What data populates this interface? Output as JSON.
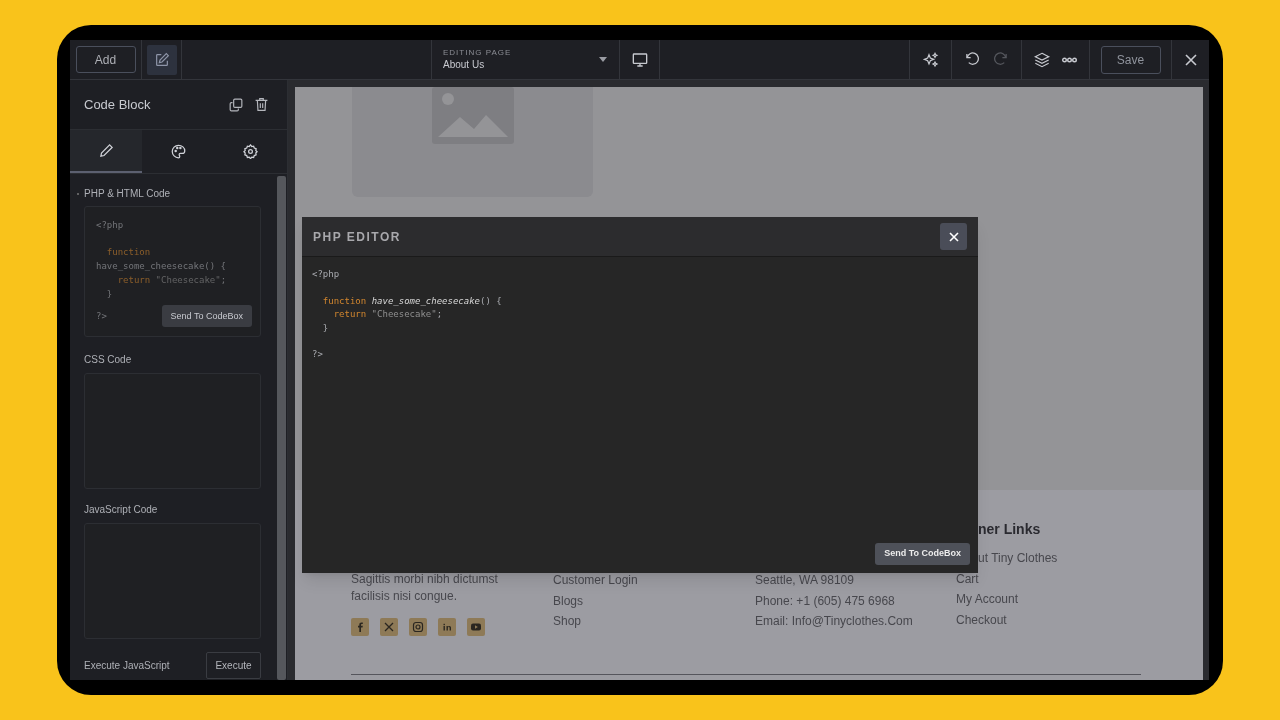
{
  "toolbar": {
    "add_button": "Add",
    "editing_label": "EDITING PAGE",
    "page_name": "About Us",
    "redo": {
      "disabled": true
    },
    "save_button": "Save"
  },
  "panel": {
    "title": "Code Block",
    "tabs": [
      {
        "kind": "pencil",
        "selected": true
      },
      {
        "kind": "palette",
        "selected": false
      },
      {
        "kind": "gear",
        "selected": false
      }
    ],
    "php_label": "PHP & HTML Code",
    "php_code": [
      {
        "lines": [
          {
            "tokens": [
              {
                "kind": "plain",
                "text": "<?php"
              }
            ]
          }
        ]
      },
      {
        "lines": [
          {
            "tokens": [
              {
                "kind": "keyword",
                "text": "  function"
              },
              {
                "kind": "plain",
                "text": " have_some_cheesecake() {"
              }
            ]
          },
          {
            "tokens": [
              {
                "kind": "keyword",
                "text": "    return"
              },
              {
                "kind": "string",
                "text": " \"Cheesecake\""
              },
              {
                "kind": "plain",
                "text": ";"
              }
            ]
          },
          {
            "tokens": [
              {
                "kind": "plain",
                "text": "  }"
              }
            ]
          }
        ]
      }
    ],
    "php_end": "?>",
    "send_button": "Send To CodeBox",
    "css_label": "CSS Code",
    "js_label": "JavaScript Code",
    "execute_label": "Execute JavaScript",
    "execute_button": "Execute"
  },
  "modal": {
    "title": "PHP EDITOR",
    "code": [
      {
        "lines": [
          {
            "tokens": [
              {
                "kind": "plain",
                "text": "<?php"
              }
            ]
          }
        ]
      },
      {
        "lines": [
          {
            "tokens": [
              {
                "kind": "keyword",
                "text": "  function "
              },
              {
                "kind": "func",
                "text": "have_some_cheesecake"
              },
              {
                "kind": "plain",
                "text": "() {"
              }
            ]
          },
          {
            "tokens": [
              {
                "kind": "keyword",
                "text": "    return"
              },
              {
                "kind": "string",
                "text": " \"Cheesecake\""
              },
              {
                "kind": "plain",
                "text": ";"
              }
            ]
          },
          {
            "tokens": [
              {
                "kind": "plain",
                "text": "  }"
              }
            ]
          }
        ]
      },
      {
        "lines": [
          {
            "tokens": [
              {
                "kind": "plain",
                "text": "?>"
              }
            ]
          }
        ]
      }
    ],
    "send_button": "Send To CodeBox"
  },
  "footer": {
    "about_text": "Sagittis morbi nibh dictumst facilisis nisi congue.",
    "links": [
      "Customer Login",
      "Blogs",
      "Shop"
    ],
    "contact": [
      "Seattle, WA 98109",
      "Phone: +1 (605) 475 6968",
      "Email: Info@Tinyclothes.Com"
    ],
    "customer_heading": "ner Links",
    "customer_links": [
      "ut Tiny Clothes",
      "Cart",
      "My Account",
      "Checkout"
    ]
  }
}
